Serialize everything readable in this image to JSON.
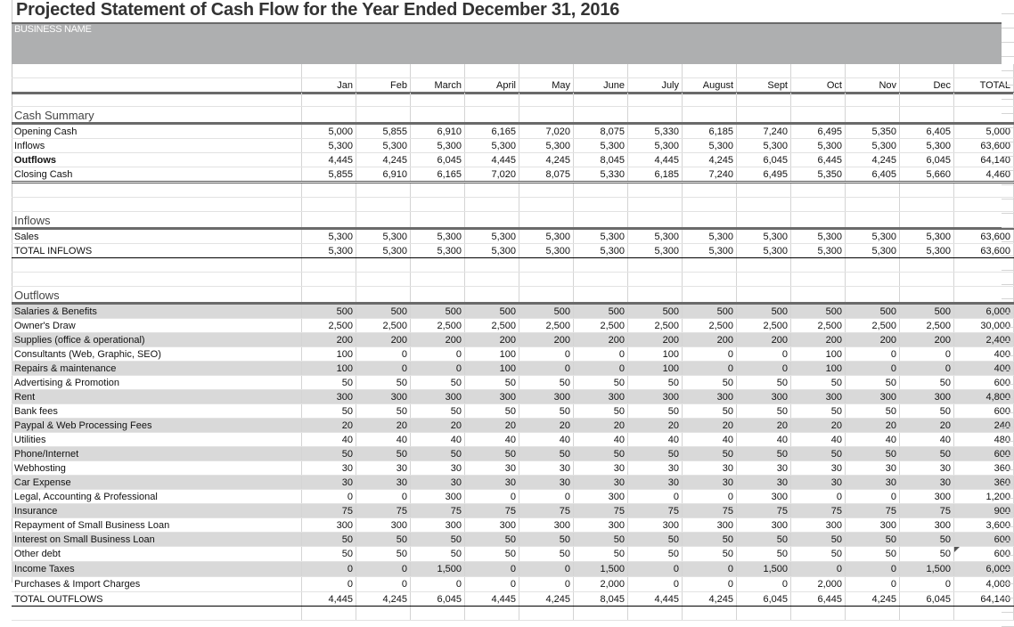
{
  "title": "Projected Statement of Cash Flow for the Year Ended December 31, 2016",
  "business_name": "BUSINESS NAME",
  "columns": [
    "Jan",
    "Feb",
    "March",
    "April",
    "May",
    "June",
    "July",
    "August",
    "Sept",
    "Oct",
    "Nov",
    "Dec",
    "TOTAL"
  ],
  "cash_summary": {
    "heading": "Cash Summary",
    "rows": [
      {
        "label": "Opening Cash",
        "values": [
          "5,000",
          "5,855",
          "6,910",
          "6,165",
          "7,020",
          "8,075",
          "5,330",
          "6,185",
          "7,240",
          "6,495",
          "5,350",
          "6,405",
          "5,000"
        ]
      },
      {
        "label": "Inflows",
        "values": [
          "5,300",
          "5,300",
          "5,300",
          "5,300",
          "5,300",
          "5,300",
          "5,300",
          "5,300",
          "5,300",
          "5,300",
          "5,300",
          "5,300",
          "63,600"
        ]
      },
      {
        "label": "Outflows",
        "values": [
          "4,445",
          "4,245",
          "6,045",
          "4,445",
          "4,245",
          "8,045",
          "4,445",
          "4,245",
          "6,045",
          "6,445",
          "4,245",
          "6,045",
          "64,140"
        ]
      },
      {
        "label": "Closing Cash",
        "values": [
          "5,855",
          "6,910",
          "6,165",
          "7,020",
          "8,075",
          "5,330",
          "6,185",
          "7,240",
          "6,495",
          "5,350",
          "6,405",
          "5,660",
          "4,460"
        ]
      }
    ]
  },
  "inflows": {
    "heading": "Inflows",
    "rows": [
      {
        "label": "Sales",
        "values": [
          "5,300",
          "5,300",
          "5,300",
          "5,300",
          "5,300",
          "5,300",
          "5,300",
          "5,300",
          "5,300",
          "5,300",
          "5,300",
          "5,300",
          "63,600"
        ]
      },
      {
        "label": "TOTAL INFLOWS",
        "values": [
          "5,300",
          "5,300",
          "5,300",
          "5,300",
          "5,300",
          "5,300",
          "5,300",
          "5,300",
          "5,300",
          "5,300",
          "5,300",
          "5,300",
          "63,600"
        ]
      }
    ]
  },
  "outflows": {
    "heading": "Outflows",
    "rows": [
      {
        "label": "Salaries & Benefits",
        "values": [
          "500",
          "500",
          "500",
          "500",
          "500",
          "500",
          "500",
          "500",
          "500",
          "500",
          "500",
          "500",
          "6,000"
        ]
      },
      {
        "label": "Owner's Draw",
        "values": [
          "2,500",
          "2,500",
          "2,500",
          "2,500",
          "2,500",
          "2,500",
          "2,500",
          "2,500",
          "2,500",
          "2,500",
          "2,500",
          "2,500",
          "30,000"
        ]
      },
      {
        "label": "Supplies (office & operational)",
        "values": [
          "200",
          "200",
          "200",
          "200",
          "200",
          "200",
          "200",
          "200",
          "200",
          "200",
          "200",
          "200",
          "2,400"
        ]
      },
      {
        "label": "Consultants (Web, Graphic, SEO)",
        "values": [
          "100",
          "0",
          "0",
          "100",
          "0",
          "0",
          "100",
          "0",
          "0",
          "100",
          "0",
          "0",
          "400"
        ]
      },
      {
        "label": "Repairs & maintenance",
        "values": [
          "100",
          "0",
          "0",
          "100",
          "0",
          "0",
          "100",
          "0",
          "0",
          "100",
          "0",
          "0",
          "400"
        ]
      },
      {
        "label": "Advertising & Promotion",
        "values": [
          "50",
          "50",
          "50",
          "50",
          "50",
          "50",
          "50",
          "50",
          "50",
          "50",
          "50",
          "50",
          "600"
        ]
      },
      {
        "label": "Rent",
        "values": [
          "300",
          "300",
          "300",
          "300",
          "300",
          "300",
          "300",
          "300",
          "300",
          "300",
          "300",
          "300",
          "4,800"
        ]
      },
      {
        "label": "Bank fees",
        "values": [
          "50",
          "50",
          "50",
          "50",
          "50",
          "50",
          "50",
          "50",
          "50",
          "50",
          "50",
          "50",
          "600"
        ]
      },
      {
        "label": "Paypal & Web Processing Fees",
        "values": [
          "20",
          "20",
          "20",
          "20",
          "20",
          "20",
          "20",
          "20",
          "20",
          "20",
          "20",
          "20",
          "240"
        ]
      },
      {
        "label": "Utilities",
        "values": [
          "40",
          "40",
          "40",
          "40",
          "40",
          "40",
          "40",
          "40",
          "40",
          "40",
          "40",
          "40",
          "480"
        ]
      },
      {
        "label": "Phone/Internet",
        "values": [
          "50",
          "50",
          "50",
          "50",
          "50",
          "50",
          "50",
          "50",
          "50",
          "50",
          "50",
          "50",
          "600"
        ]
      },
      {
        "label": "Webhosting",
        "values": [
          "30",
          "30",
          "30",
          "30",
          "30",
          "30",
          "30",
          "30",
          "30",
          "30",
          "30",
          "30",
          "360"
        ]
      },
      {
        "label": "Car Expense",
        "values": [
          "30",
          "30",
          "30",
          "30",
          "30",
          "30",
          "30",
          "30",
          "30",
          "30",
          "30",
          "30",
          "360"
        ]
      },
      {
        "label": "Legal, Accounting & Professional",
        "values": [
          "0",
          "0",
          "300",
          "0",
          "0",
          "300",
          "0",
          "0",
          "300",
          "0",
          "0",
          "300",
          "1,200"
        ]
      },
      {
        "label": "Insurance",
        "values": [
          "75",
          "75",
          "75",
          "75",
          "75",
          "75",
          "75",
          "75",
          "75",
          "75",
          "75",
          "75",
          "900"
        ]
      },
      {
        "label": "Repayment of Small Business Loan",
        "values": [
          "300",
          "300",
          "300",
          "300",
          "300",
          "300",
          "300",
          "300",
          "300",
          "300",
          "300",
          "300",
          "3,600"
        ]
      },
      {
        "label": "Interest on Small Business Loan",
        "values": [
          "50",
          "50",
          "50",
          "50",
          "50",
          "50",
          "50",
          "50",
          "50",
          "50",
          "50",
          "50",
          "600"
        ]
      },
      {
        "label": "Other debt",
        "values": [
          "50",
          "50",
          "50",
          "50",
          "50",
          "50",
          "50",
          "50",
          "50",
          "50",
          "50",
          "50",
          "600"
        ]
      },
      {
        "label": "Income Taxes",
        "values": [
          "0",
          "0",
          "1,500",
          "0",
          "0",
          "1,500",
          "0",
          "0",
          "1,500",
          "0",
          "0",
          "1,500",
          "6,000"
        ]
      },
      {
        "label": "Purchases & Import Charges",
        "values": [
          "0",
          "0",
          "0",
          "0",
          "0",
          "2,000",
          "0",
          "0",
          "0",
          "2,000",
          "0",
          "0",
          "4,000"
        ]
      },
      {
        "label": "TOTAL OUTFLOWS",
        "values": [
          "4,445",
          "4,245",
          "6,045",
          "4,445",
          "4,245",
          "8,045",
          "4,445",
          "4,245",
          "6,045",
          "6,445",
          "4,245",
          "6,045",
          "64,140"
        ]
      }
    ]
  }
}
